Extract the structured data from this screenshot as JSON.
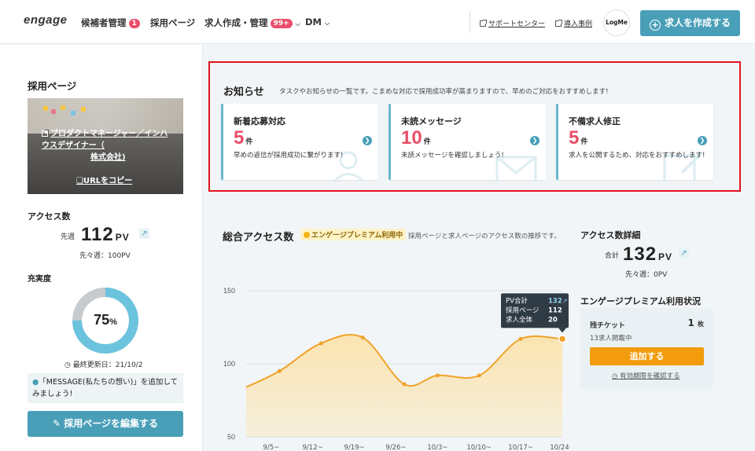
{
  "header": {
    "logo": "engage",
    "nav": [
      {
        "label": "候補者管理",
        "badge": "1"
      },
      {
        "label": "採用ページ"
      },
      {
        "label": "求人作成・管理",
        "badge": "99+"
      },
      {
        "label": "DM"
      }
    ],
    "links": [
      "サポートセンター",
      "導入事例"
    ],
    "avatar_text": "LogMe",
    "create_button": "求人を作成する"
  },
  "sidebar": {
    "title": "採用ページ",
    "photo_link": "プロダクトマネージャー／インハウスデザイナー（",
    "photo_link2": "株式会社)",
    "copy_url": "URLをコピー",
    "access": {
      "title": "アクセス数",
      "label": "先週",
      "value": "112",
      "unit": "PV",
      "prev": "先々週：100PV"
    },
    "completeness": {
      "title": "充実度",
      "percent": 75,
      "percent_label": "75",
      "percent_unit": "%",
      "updated": "最終更新日：21/10/2"
    },
    "hint": "「MESSAGE(私たちの想い)」を追加してみましょう!",
    "edit_button": "採用ページを編集する"
  },
  "notice": {
    "title": "お知らせ",
    "desc": "タスクやお知らせの一覧です。こまめな対応で採用成功率が高まりますので、早めのご対応をおすすめします!",
    "cards": [
      {
        "title": "新着応募対応",
        "count": "5",
        "unit": "件",
        "desc": "早めの返信が採用成功に繋がります!"
      },
      {
        "title": "未読メッセージ",
        "count": "10",
        "unit": "件",
        "desc": "未読メッセージを確認しましょう!"
      },
      {
        "title": "不備求人修正",
        "count": "5",
        "unit": "件",
        "desc": "求人を公開するため、対応をおすすめします!"
      }
    ]
  },
  "main": {
    "title": "総合アクセス数",
    "premium_badge": "エンゲージプレミアム利用中",
    "desc": "採用ページと求人ページのアクセス数の推移です。"
  },
  "chart_data": {
    "type": "area",
    "x": [
      "9/5",
      "9/12",
      "9/19",
      "9/26",
      "10/3",
      "10/10",
      "10/17",
      "10/24"
    ],
    "x_partial_labels": [
      "9/5~",
      "9/12~",
      "9/19~",
      "9/26~",
      "10/3~",
      "10/10~",
      "10/17~",
      "10/24~"
    ],
    "y_ticks": [
      150,
      100,
      50
    ],
    "ylim": [
      50,
      150
    ],
    "series": [
      {
        "points": [
          [
            0,
            84
          ],
          [
            0.8,
            95
          ],
          [
            1.8,
            114
          ],
          [
            2.8,
            118
          ],
          [
            3.8,
            86
          ],
          [
            4.6,
            92
          ],
          [
            5.6,
            92
          ],
          [
            6.6,
            117
          ],
          [
            7.6,
            117
          ]
        ]
      }
    ],
    "tooltip": {
      "rows": [
        {
          "label": "PV合計",
          "value": "132"
        },
        {
          "label": "採用ページ",
          "value": "112"
        },
        {
          "label": "求人全体",
          "value": "20"
        }
      ]
    },
    "colors": {
      "line": "#f0a22a",
      "fill": "#fce2a8",
      "grid": "#d6e0e6"
    }
  },
  "right": {
    "detail_title": "アクセス数詳細",
    "total_label": "合計",
    "total_value": "132",
    "total_unit": "PV",
    "total_prev": "先々週：0PV",
    "premium_title": "エンゲージプレミアム利用状況",
    "ticket_label": "残チケット",
    "ticket_value": "1",
    "ticket_unit": "枚",
    "ticket_sub": "13求人掲載中",
    "add_button": "追加する",
    "expiry_link": "有効期限を確認する"
  }
}
